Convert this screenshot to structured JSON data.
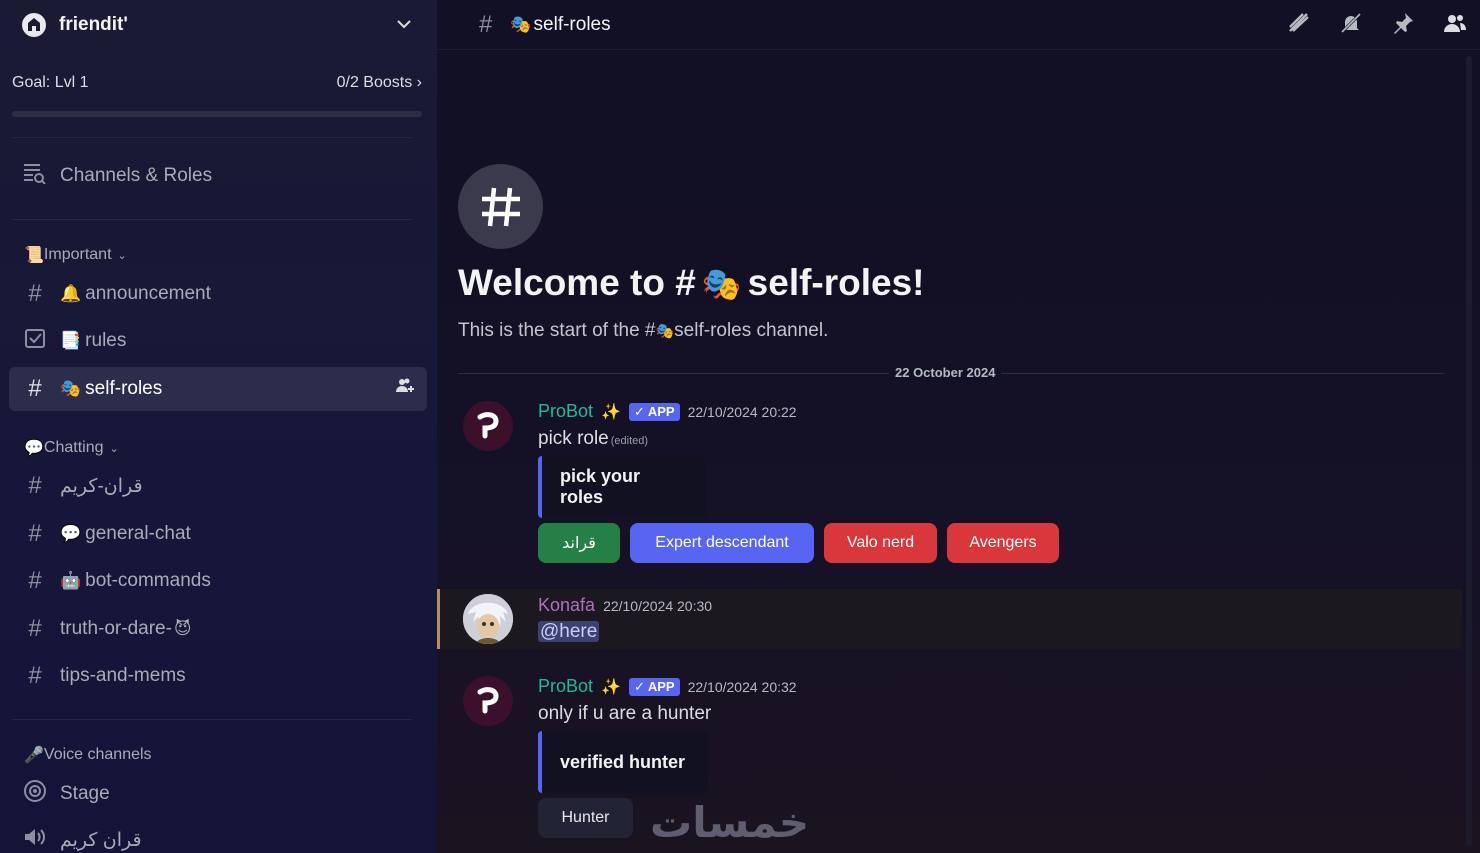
{
  "server": {
    "name": "friendit'",
    "icon": "server-icon"
  },
  "goal": {
    "label": "Goal: Lvl 1",
    "boosts": "0/2 Boosts",
    "progress": 0
  },
  "channels_roles": {
    "label": "Channels & Roles"
  },
  "categories": {
    "important": {
      "emoji": "📜",
      "label": "Important"
    },
    "chatting": {
      "emoji": "💬",
      "label": "Chatting"
    },
    "voice": {
      "emoji": "🎤",
      "label": "Voice channels"
    }
  },
  "channels": {
    "announcement": {
      "emoji": "🔔",
      "label": "announcement"
    },
    "rules": {
      "emoji": "📑",
      "label": "rules"
    },
    "self_roles": {
      "emoji": "🎭",
      "label": "self-roles"
    },
    "quran": {
      "label": "قران-كريم"
    },
    "general": {
      "emoji": "💬",
      "label": "general-chat"
    },
    "bot": {
      "emoji": "🤖",
      "label": "bot-commands"
    },
    "truth": {
      "label": "truth-or-dare-",
      "emoji": "😈"
    },
    "tips": {
      "label": "tips-and-mems"
    },
    "stage": {
      "label": "Stage"
    },
    "quran_voice": {
      "label": "قران كريم"
    }
  },
  "topbar": {
    "channel_emoji": "🎭",
    "channel_name": "self-roles"
  },
  "welcome": {
    "title_prefix": "Welcome to #",
    "title_emoji": "🎭",
    "title_suffix": "self-roles!",
    "sub_prefix": "This is the start of the #",
    "sub_emoji": "🎭",
    "sub_suffix": "self-roles channel."
  },
  "date_divider": "22 October 2024",
  "messages": [
    {
      "author": "ProBot",
      "sparkle": "✨",
      "tag": "APP",
      "time": "22/10/2024 20:22",
      "text": "pick role",
      "edited": "(edited)",
      "embed": "pick your roles",
      "buttons": [
        "قراند",
        "Expert descendant",
        "Valo nerd",
        "Avengers"
      ]
    },
    {
      "author": "Konafa",
      "time": "22/10/2024 20:30",
      "text": "@here"
    },
    {
      "author": "ProBot",
      "sparkle": "✨",
      "tag": "APP",
      "time": "22/10/2024 20:32",
      "text": "only if u are a hunter",
      "embed": "verified hunter",
      "buttons": [
        "Hunter"
      ]
    }
  ],
  "watermark": "خمسات",
  "colors": {
    "accent": "#5865f2",
    "green_button": "#248045",
    "red_button": "#da373c",
    "probot_name": "#1abc9c",
    "konafa_name": "#b36fbf"
  }
}
